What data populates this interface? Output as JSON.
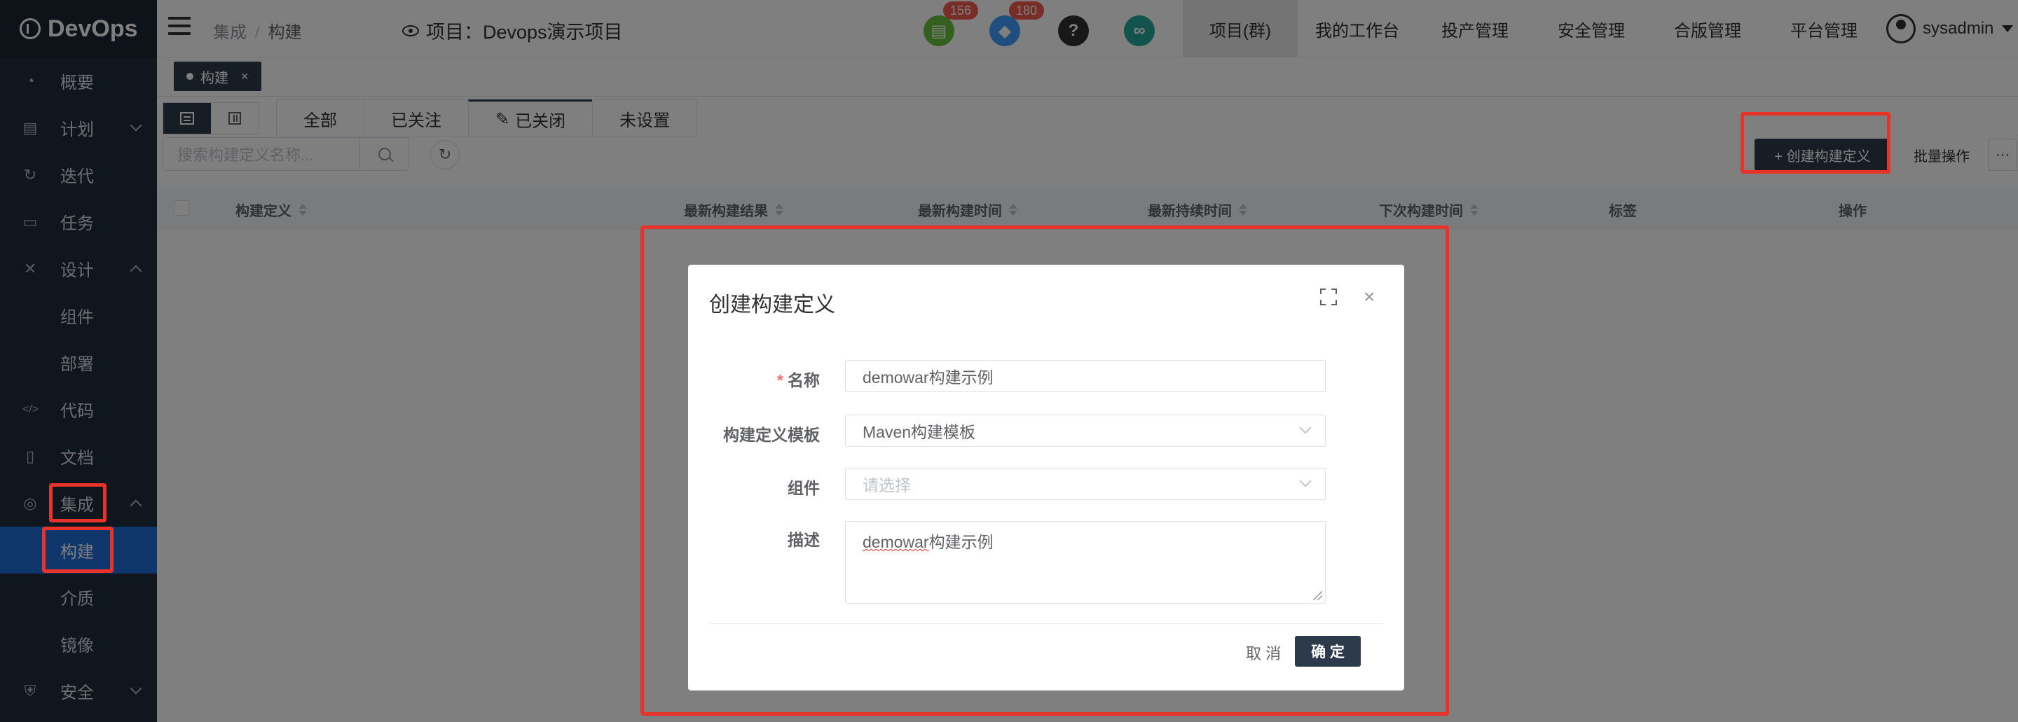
{
  "app": {
    "logo": "DevOps"
  },
  "sidebar": {
    "items": [
      {
        "label": "概要",
        "icon": "dashboard-icon"
      },
      {
        "label": "计划",
        "icon": "calendar-icon"
      },
      {
        "label": "迭代",
        "icon": "loop-icon"
      },
      {
        "label": "任务",
        "icon": "folder-icon"
      },
      {
        "label": "设计",
        "icon": "tools-icon"
      },
      {
        "label": "组件"
      },
      {
        "label": "部署"
      },
      {
        "label": "代码",
        "icon": "code-icon"
      },
      {
        "label": "文档",
        "icon": "document-icon"
      },
      {
        "label": "集成",
        "icon": "integration-icon"
      },
      {
        "label": "构建"
      },
      {
        "label": "介质"
      },
      {
        "label": "镜像"
      },
      {
        "label": "安全",
        "icon": "shield-icon"
      }
    ]
  },
  "header": {
    "breadcrumb": [
      "集成",
      "构建"
    ],
    "breadcrumb_sep": "/",
    "project": "项目：Devops演示项目",
    "badges": {
      "tasks": "156",
      "notifications": "180"
    },
    "menu": [
      "项目(群)",
      "我的工作台",
      "投产管理",
      "安全管理",
      "合版管理",
      "平台管理"
    ],
    "user": "sysadmin"
  },
  "tagbar": {
    "tag": "构建",
    "close": "×"
  },
  "content": {
    "tabs": [
      "全部",
      "已关注",
      "已关闭",
      "未设置"
    ],
    "search_placeholder": "搜索构建定义名称...",
    "create_button": "+ 创建构建定义",
    "batch_button": "批量操作",
    "more_button": "···",
    "columns": [
      "构建定义",
      "最新构建结果",
      "最新构建时间",
      "最新持续时间",
      "下次构建时间",
      "标签",
      "操作"
    ]
  },
  "modal": {
    "title": "创建构建定义",
    "close": "×",
    "fields": {
      "name": {
        "label": "名称",
        "required_mark": "*",
        "value": "demowar构建示例"
      },
      "template": {
        "label": "构建定义模板",
        "value": "Maven构建模板"
      },
      "component": {
        "label": "组件",
        "placeholder": "请选择"
      },
      "desc": {
        "label": "描述",
        "value_underlined": "demowar",
        "value_rest": "构建示例"
      }
    },
    "cancel": "取 消",
    "ok": "确 定"
  },
  "colors": {
    "sidebar_bg": "#1f2d3d",
    "active_blue": "#1e6fd9",
    "primary_dark": "#2d3a4b",
    "badge_red": "#f05a4f",
    "highlight_red": "#e8332a"
  }
}
